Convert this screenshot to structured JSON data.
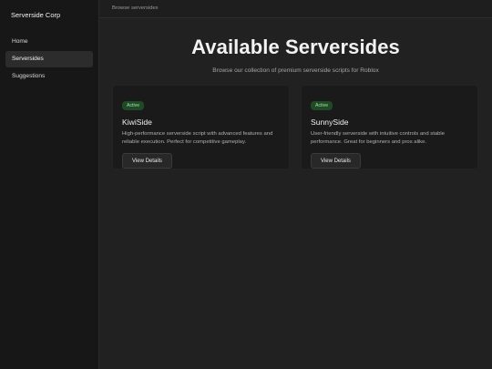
{
  "sidebar": {
    "brand": "Serverside Corp",
    "items": [
      {
        "label": "Home",
        "active": false
      },
      {
        "label": "Serversides",
        "active": true
      },
      {
        "label": "Suggestions",
        "active": false
      }
    ]
  },
  "topbar": {
    "breadcrumb": "Browse serversides"
  },
  "hero": {
    "title": "Available Serversides",
    "subtitle": "Browse our collection of premium serverside scripts for Roblox"
  },
  "cards": [
    {
      "status": "Active",
      "title": "KiwiSide",
      "description": "High-performance serverside script with advanced features and reliable execution. Perfect for competitive gameplay.",
      "button_label": "View Details"
    },
    {
      "status": "Active",
      "title": "SunnySide",
      "description": "User-friendly serverside with intuitive controls and stable performance. Great for beginners and pros alike.",
      "button_label": "View Details"
    }
  ],
  "colors": {
    "background": "#212121",
    "sidebar": "#171717",
    "card": "#1a1a1a",
    "badge_bg": "#1f4a25",
    "badge_text": "#9fe0a6"
  }
}
